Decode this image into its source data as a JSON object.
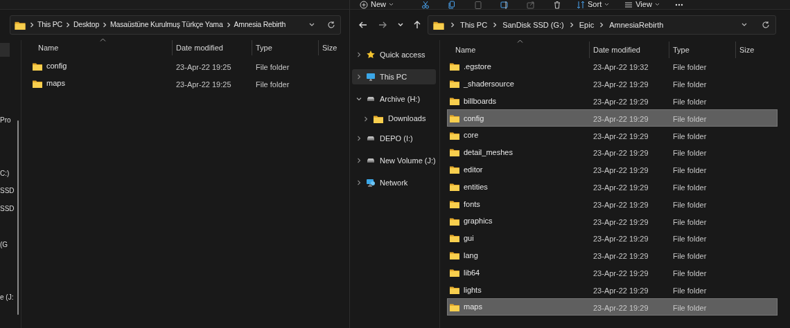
{
  "left_window": {
    "nav_pane_items": [
      "Pro",
      "C:)",
      "SSD",
      "SSD",
      "(G",
      "e (J:"
    ],
    "address_bar": {
      "breadcrumbs": [
        "This PC",
        "Desktop",
        "Masaüstüne Kurulmuş Türkçe Yama",
        "Amnesia Rebirth"
      ]
    },
    "columns": [
      "Name",
      "Date modified",
      "Type",
      "Size"
    ],
    "rows": [
      {
        "name": "config",
        "date_modified": "23-Apr-22 19:25",
        "type": "File folder",
        "selected": false
      },
      {
        "name": "maps",
        "date_modified": "23-Apr-22 19:25",
        "type": "File folder",
        "selected": false
      }
    ]
  },
  "right_window": {
    "toolbar": [
      {
        "kind": "new",
        "label": "New"
      },
      {
        "kind": "cut"
      },
      {
        "kind": "copy"
      },
      {
        "kind": "paste"
      },
      {
        "kind": "rename"
      },
      {
        "kind": "share"
      },
      {
        "kind": "delete"
      },
      {
        "kind": "sort",
        "label": "Sort"
      },
      {
        "kind": "view",
        "label": "View"
      },
      {
        "kind": "more"
      }
    ],
    "address_bar": {
      "breadcrumbs": [
        "This PC",
        "SanDisk SSD (G:)",
        "Epic",
        "AmnesiaRebirth"
      ]
    },
    "sidebar": [
      {
        "kind": "quick_access",
        "label": "Quick access",
        "expanded": false,
        "selected": false
      },
      {
        "kind": "pc",
        "label": "This PC",
        "expanded": false,
        "selected": true
      },
      {
        "kind": "drive",
        "label": "Archive (H:)",
        "expanded": true,
        "selected": false,
        "children": [
          {
            "kind": "folder",
            "label": "Downloads",
            "expanded": false,
            "selected": false
          }
        ]
      },
      {
        "kind": "drive",
        "label": "DEPO (I:)",
        "expanded": false,
        "selected": false
      },
      {
        "kind": "drive",
        "label": "New Volume (J:)",
        "expanded": false,
        "selected": false
      },
      {
        "kind": "network",
        "label": "Network",
        "expanded": false,
        "selected": false
      }
    ],
    "columns": [
      "Name",
      "Date modified",
      "Type",
      "Size"
    ],
    "rows": [
      {
        "name": ".egstore",
        "date_modified": "23-Apr-22 19:32",
        "type": "File folder",
        "selected": false
      },
      {
        "name": "_shadersource",
        "date_modified": "23-Apr-22 19:29",
        "type": "File folder",
        "selected": false
      },
      {
        "name": "billboards",
        "date_modified": "23-Apr-22 19:29",
        "type": "File folder",
        "selected": false
      },
      {
        "name": "config",
        "date_modified": "23-Apr-22 19:29",
        "type": "File folder",
        "selected": true
      },
      {
        "name": "core",
        "date_modified": "23-Apr-22 19:29",
        "type": "File folder",
        "selected": false
      },
      {
        "name": "detail_meshes",
        "date_modified": "23-Apr-22 19:29",
        "type": "File folder",
        "selected": false
      },
      {
        "name": "editor",
        "date_modified": "23-Apr-22 19:29",
        "type": "File folder",
        "selected": false
      },
      {
        "name": "entities",
        "date_modified": "23-Apr-22 19:29",
        "type": "File folder",
        "selected": false
      },
      {
        "name": "fonts",
        "date_modified": "23-Apr-22 19:29",
        "type": "File folder",
        "selected": false
      },
      {
        "name": "graphics",
        "date_modified": "23-Apr-22 19:29",
        "type": "File folder",
        "selected": false
      },
      {
        "name": "gui",
        "date_modified": "23-Apr-22 19:29",
        "type": "File folder",
        "selected": false
      },
      {
        "name": "lang",
        "date_modified": "23-Apr-22 19:29",
        "type": "File folder",
        "selected": false
      },
      {
        "name": "lib64",
        "date_modified": "23-Apr-22 19:29",
        "type": "File folder",
        "selected": false
      },
      {
        "name": "lights",
        "date_modified": "23-Apr-22 19:29",
        "type": "File folder",
        "selected": false
      },
      {
        "name": "maps",
        "date_modified": "23-Apr-22 19:29",
        "type": "File folder",
        "selected": true
      }
    ]
  }
}
